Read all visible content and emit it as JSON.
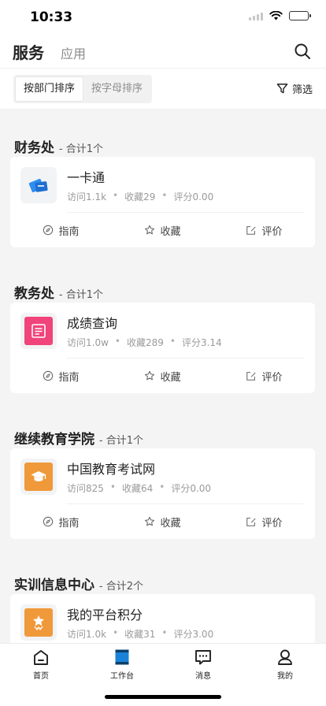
{
  "status": {
    "time": "10:33"
  },
  "header": {
    "tab_service": "服务",
    "tab_apps": "应用",
    "search_icon": "search-icon"
  },
  "filter": {
    "sort_by_dept": "按部门排序",
    "sort_by_alpha": "按字母排序",
    "filter_label": "筛选",
    "active": "sort_by_dept"
  },
  "sections": [
    {
      "title": "财务处",
      "count": "- 合计1个",
      "app": {
        "name": "一卡通",
        "visits": "访问1.1k",
        "favorites": "收藏29",
        "rating": "评分0.00",
        "icon": "card-icon",
        "color": "#2f8ef0"
      }
    },
    {
      "title": "教务处",
      "count": "- 合计1个",
      "app": {
        "name": "成绩查询",
        "visits": "访问1.0w",
        "favorites": "收藏289",
        "rating": "评分3.14",
        "icon": "report-icon",
        "color": "#f0447a"
      }
    },
    {
      "title": "继续教育学院",
      "count": "- 合计1个",
      "app": {
        "name": "中国教育考试网",
        "visits": "访问825",
        "favorites": "收藏64",
        "rating": "评分0.00",
        "icon": "graduation-cap-icon",
        "color": "#f0993a"
      }
    },
    {
      "title": "实训信息中心",
      "count": "- 合计2个",
      "app": {
        "name": "我的平台积分",
        "visits": "访问1.0k",
        "favorites": "收藏31",
        "rating": "评分3.00",
        "icon": "badge-icon",
        "color": "#f0993a"
      }
    }
  ],
  "actions": {
    "guide": "指南",
    "favorite": "收藏",
    "review": "评价"
  },
  "tabbar": [
    {
      "label": "首页",
      "icon": "home-icon"
    },
    {
      "label": "工作台",
      "icon": "workbench-icon"
    },
    {
      "label": "消息",
      "icon": "message-icon"
    },
    {
      "label": "我的",
      "icon": "profile-icon"
    }
  ]
}
